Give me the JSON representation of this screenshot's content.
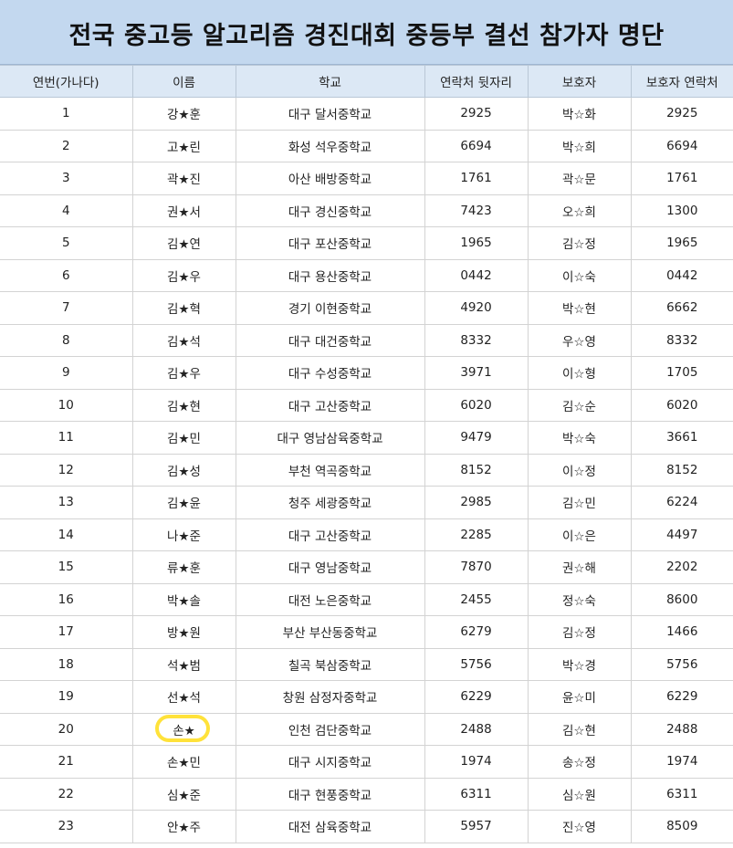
{
  "title": "전국 중고등 알고리즘 경진대회 중등부 결선 참가자 명단",
  "columns": [
    "연번(가나다)",
    "이름",
    "학교",
    "연락처 뒷자리",
    "보호자",
    "보호자 연락처"
  ],
  "highlighted_row": 20,
  "highlight_color": "#ffe23a",
  "rows": [
    {
      "no": "1",
      "name": "강★훈",
      "school": "대구 달서중학교",
      "phone": "2925",
      "guardian": "박☆화",
      "guardian_phone": "2925"
    },
    {
      "no": "2",
      "name": "고★린",
      "school": "화성 석우중학교",
      "phone": "6694",
      "guardian": "박☆희",
      "guardian_phone": "6694"
    },
    {
      "no": "3",
      "name": "곽★진",
      "school": "아산 배방중학교",
      "phone": "1761",
      "guardian": "곽☆문",
      "guardian_phone": "1761"
    },
    {
      "no": "4",
      "name": "권★서",
      "school": "대구 경신중학교",
      "phone": "7423",
      "guardian": "오☆희",
      "guardian_phone": "1300"
    },
    {
      "no": "5",
      "name": "김★연",
      "school": "대구 포산중학교",
      "phone": "1965",
      "guardian": "김☆정",
      "guardian_phone": "1965"
    },
    {
      "no": "6",
      "name": "김★우",
      "school": "대구 용산중학교",
      "phone": "0442",
      "guardian": "이☆숙",
      "guardian_phone": "0442"
    },
    {
      "no": "7",
      "name": "김★혁",
      "school": "경기 이현중학교",
      "phone": "4920",
      "guardian": "박☆현",
      "guardian_phone": "6662"
    },
    {
      "no": "8",
      "name": "김★석",
      "school": "대구 대건중학교",
      "phone": "8332",
      "guardian": "우☆영",
      "guardian_phone": "8332"
    },
    {
      "no": "9",
      "name": "김★우",
      "school": "대구 수성중학교",
      "phone": "3971",
      "guardian": "이☆형",
      "guardian_phone": "1705"
    },
    {
      "no": "10",
      "name": "김★현",
      "school": "대구 고산중학교",
      "phone": "6020",
      "guardian": "김☆순",
      "guardian_phone": "6020"
    },
    {
      "no": "11",
      "name": "김★민",
      "school": "대구 영남삼육중학교",
      "phone": "9479",
      "guardian": "박☆숙",
      "guardian_phone": "3661"
    },
    {
      "no": "12",
      "name": "김★성",
      "school": "부천 역곡중학교",
      "phone": "8152",
      "guardian": "이☆정",
      "guardian_phone": "8152"
    },
    {
      "no": "13",
      "name": "김★윤",
      "school": "청주 세광중학교",
      "phone": "2985",
      "guardian": "김☆민",
      "guardian_phone": "6224"
    },
    {
      "no": "14",
      "name": "나★준",
      "school": "대구 고산중학교",
      "phone": "2285",
      "guardian": "이☆은",
      "guardian_phone": "4497"
    },
    {
      "no": "15",
      "name": "류★훈",
      "school": "대구 영남중학교",
      "phone": "7870",
      "guardian": "권☆해",
      "guardian_phone": "2202"
    },
    {
      "no": "16",
      "name": "박★솔",
      "school": "대전 노은중학교",
      "phone": "2455",
      "guardian": "정☆숙",
      "guardian_phone": "8600"
    },
    {
      "no": "17",
      "name": "방★원",
      "school": "부산 부산동중학교",
      "phone": "6279",
      "guardian": "김☆정",
      "guardian_phone": "1466"
    },
    {
      "no": "18",
      "name": "석★범",
      "school": "칠곡 북삼중학교",
      "phone": "5756",
      "guardian": "박☆경",
      "guardian_phone": "5756"
    },
    {
      "no": "19",
      "name": "선★석",
      "school": "창원 삼정자중학교",
      "phone": "6229",
      "guardian": "윤☆미",
      "guardian_phone": "6229"
    },
    {
      "no": "20",
      "name": "손★",
      "school": "인천 검단중학교",
      "phone": "2488",
      "guardian": "김☆현",
      "guardian_phone": "2488"
    },
    {
      "no": "21",
      "name": "손★민",
      "school": "대구 시지중학교",
      "phone": "1974",
      "guardian": "송☆정",
      "guardian_phone": "1974"
    },
    {
      "no": "22",
      "name": "심★준",
      "school": "대구 현풍중학교",
      "phone": "6311",
      "guardian": "심☆원",
      "guardian_phone": "6311"
    },
    {
      "no": "23",
      "name": "안★주",
      "school": "대전 삼육중학교",
      "phone": "5957",
      "guardian": "진☆영",
      "guardian_phone": "8509"
    }
  ]
}
